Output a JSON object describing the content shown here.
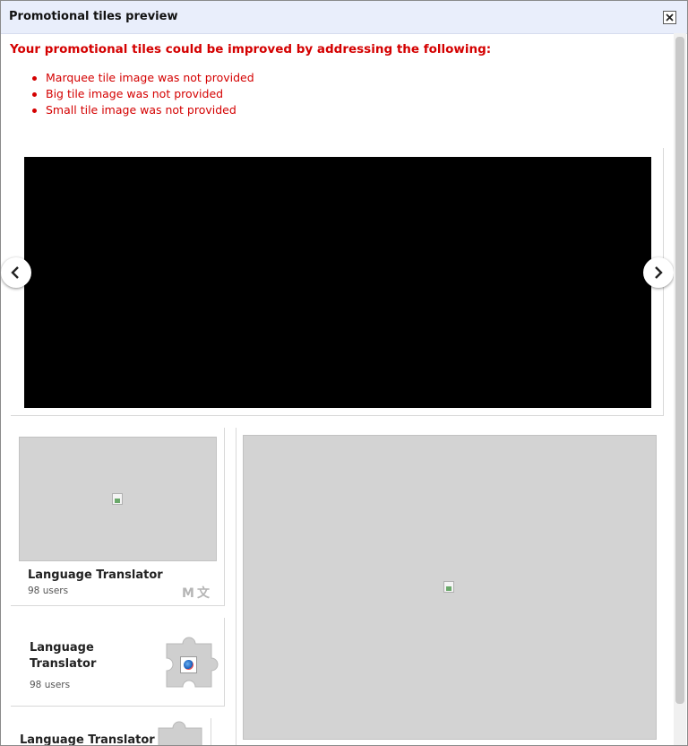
{
  "dialog": {
    "title": "Promotional tiles preview"
  },
  "warnings": {
    "heading": "Your promotional tiles could be improved by addressing the following:",
    "items": [
      "Marquee tile image was not provided",
      "Big tile image was not provided",
      "Small tile image was not provided"
    ]
  },
  "small_tile": {
    "name": "Language Translator",
    "users": "98 users",
    "icons": [
      "gmail-icon",
      "translate-icon"
    ]
  },
  "list_tile": {
    "name_line1": "Language",
    "name_line2": "Translator",
    "users": "98 users"
  },
  "list_tile_2": {
    "name": "Language Translator"
  },
  "colors": {
    "warning": "#d40000",
    "titlebar": "#e9eefb",
    "placeholder": "#d3d3d3",
    "marquee": "#000000"
  }
}
